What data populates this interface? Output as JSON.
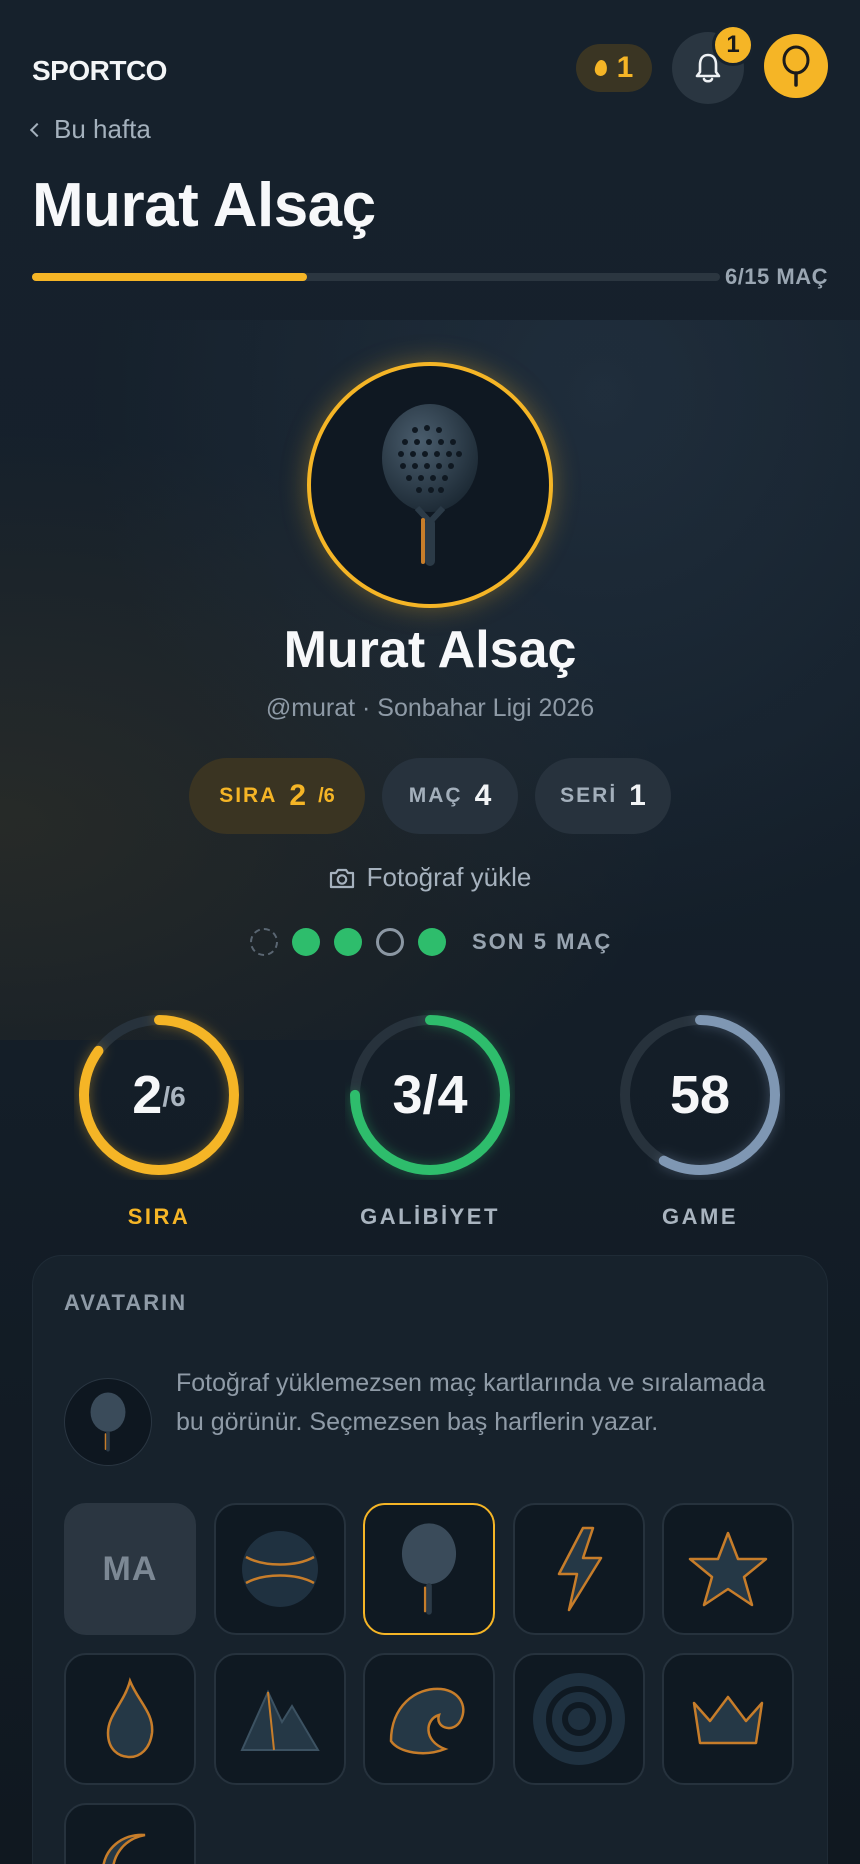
{
  "header": {
    "brand": "SPORTCO",
    "streak_count": "1",
    "notification_count": "1",
    "back_label": "Bu hafta",
    "title": "Murat Alsaç",
    "progress": {
      "played": 6,
      "total": 15,
      "label": "6/15 MAÇ"
    }
  },
  "profile": {
    "name": "Murat Alsaç",
    "subtitle": "@murat · Sonbahar Ligi 2026",
    "pills": {
      "rank_label": "SIRA",
      "rank_value": "2",
      "rank_suffix": "/6",
      "matches_label": "MAÇ",
      "matches_value": "4",
      "streak_label": "SERİ",
      "streak_value": "1"
    },
    "upload_label": "Fotoğraf yükle",
    "recent_form": {
      "results": [
        "pending",
        "win",
        "win",
        "loss",
        "win"
      ],
      "label": "SON 5 MAÇ"
    }
  },
  "stats": [
    {
      "value": "2",
      "suffix": "/6",
      "label": "SIRA",
      "progress": 0.85,
      "color": "#f5b526",
      "label_color": "#f5b526"
    },
    {
      "value": "3/4",
      "suffix": "",
      "label": "GALİBİYET",
      "progress": 0.75,
      "color": "#2ebd6c",
      "label_color": "#a9b4bf"
    },
    {
      "value": "58",
      "suffix": "",
      "label": "GAME",
      "progress": 0.58,
      "color": "#7f97b3",
      "label_color": "#a9b4bf"
    }
  ],
  "avatar_card": {
    "title": "AVATARIN",
    "description": "Fotoğraf yüklemezsen maç kartlarında ve sıralamada bu görünür. Seçmezsen baş harflerin yazar.",
    "initials": "MA",
    "options": [
      "initials",
      "ball",
      "racket",
      "bolt",
      "star",
      "flame",
      "mountain",
      "wave",
      "target",
      "crown",
      "moon"
    ],
    "selected": "racket"
  },
  "colors": {
    "accent": "#f5b526",
    "win": "#2ebd6c",
    "background": "#15202b"
  }
}
